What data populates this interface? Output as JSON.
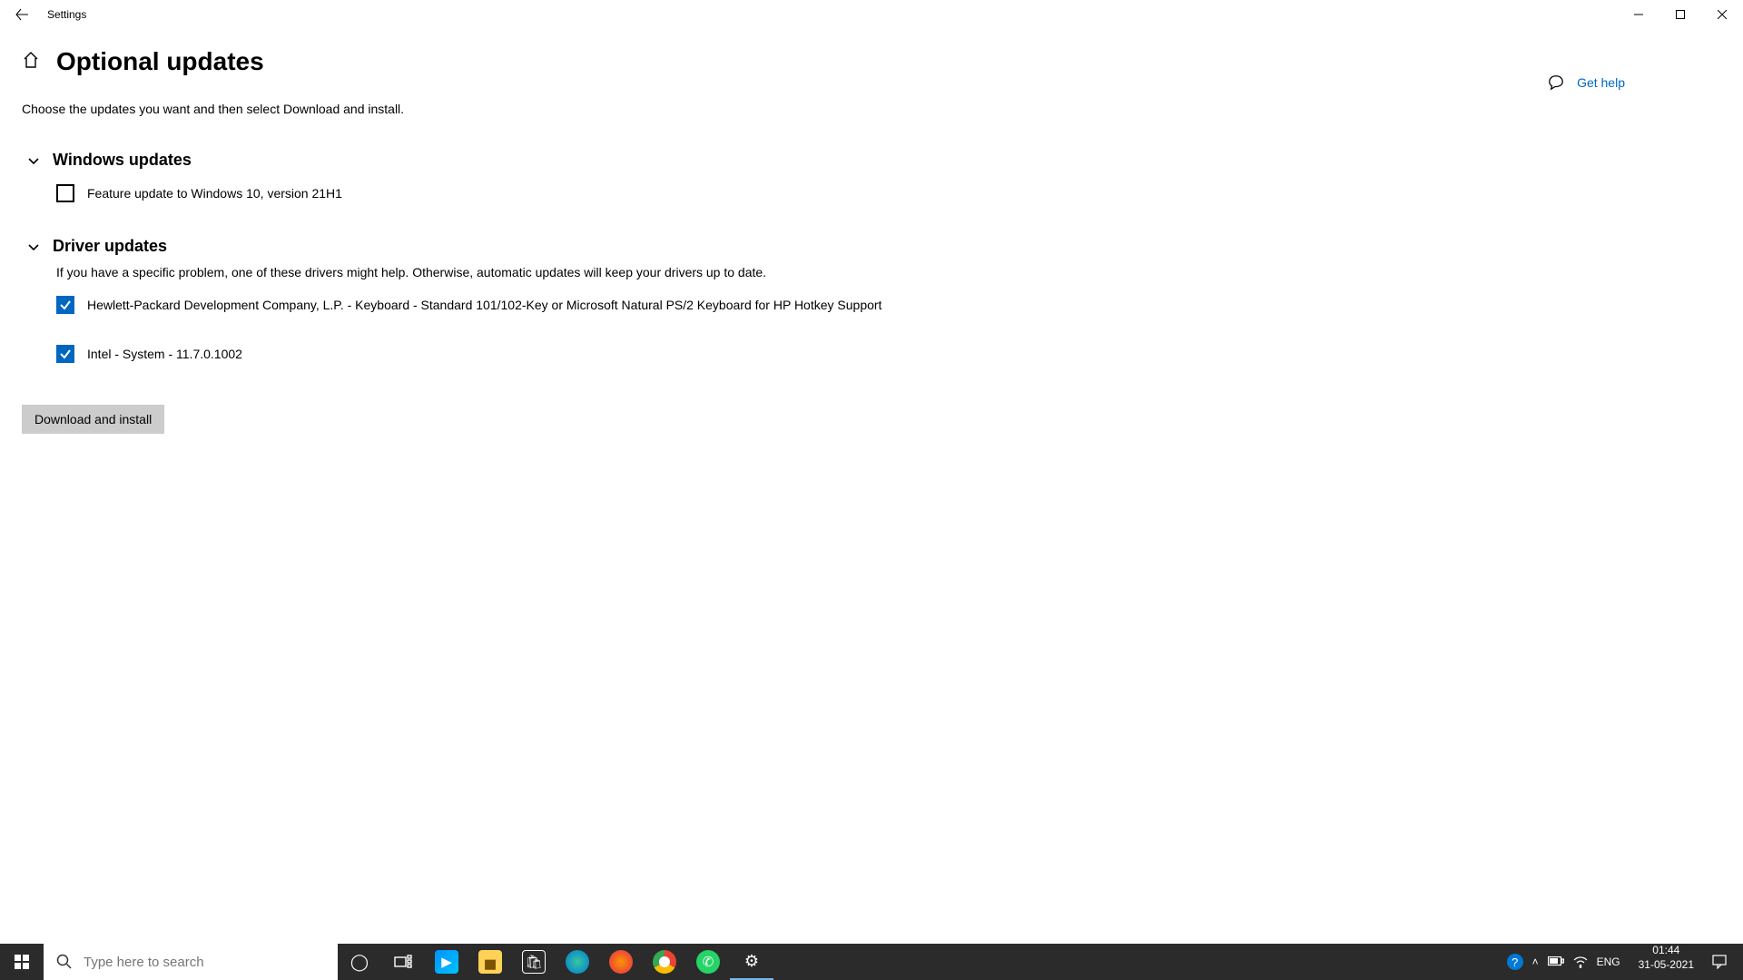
{
  "window": {
    "title": "Settings"
  },
  "page": {
    "title": "Optional updates",
    "instructions": "Choose the updates you want and then select Download and install.",
    "gethelp": "Get help"
  },
  "sections": {
    "windows_updates": {
      "title": "Windows updates",
      "items": [
        {
          "label": "Feature update to Windows 10, version 21H1",
          "checked": false
        }
      ]
    },
    "driver_updates": {
      "title": "Driver updates",
      "desc": "If you have a specific problem, one of these drivers might help. Otherwise, automatic updates will keep your drivers up to date.",
      "items": [
        {
          "label": "Hewlett-Packard Development Company, L.P. - Keyboard - Standard 101/102-Key or Microsoft Natural PS/2 Keyboard for HP Hotkey Support",
          "checked": true
        },
        {
          "label": "Intel - System - 11.7.0.1002",
          "checked": true
        }
      ]
    }
  },
  "actions": {
    "download_install": "Download and install"
  },
  "taskbar": {
    "search_placeholder": "Type here to search",
    "lang": "ENG",
    "time": "01:44",
    "date": "31-05-2021"
  }
}
